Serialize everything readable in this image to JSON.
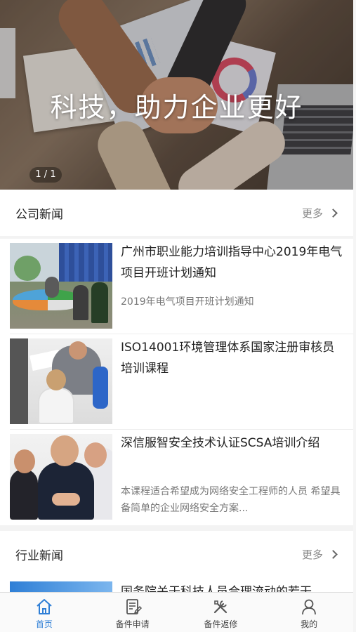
{
  "banner": {
    "slogan": "科技，助力企业更好",
    "pager": "1 / 1"
  },
  "company_news": {
    "title": "公司新闻",
    "more": "更多",
    "items": [
      {
        "title": "广州市职业能力培训指导中心2019年电气项目开班计划通知",
        "desc": "2019年电气项目开班计划通知"
      },
      {
        "title": "ISO14001环境管理体系国家注册审核员培训课程",
        "desc": ""
      },
      {
        "title": "深信服智安全技术认证SCSA培训介绍",
        "desc": "本课程适合希望成为网络安全工程师的人员 希望具备简单的企业网络安全方案..."
      }
    ]
  },
  "industry_news": {
    "title": "行业新闻",
    "more": "更多",
    "items": [
      {
        "title": "国务院关于科技人员合理流动的若干"
      }
    ]
  },
  "tabbar": {
    "accent": "#2f7fd6",
    "tabs": [
      {
        "label": "首页",
        "icon": "home-icon",
        "active": true
      },
      {
        "label": "备件申请",
        "icon": "form-icon",
        "active": false
      },
      {
        "label": "备件返修",
        "icon": "tools-icon",
        "active": false
      },
      {
        "label": "我的",
        "icon": "user-icon",
        "active": false
      }
    ]
  }
}
